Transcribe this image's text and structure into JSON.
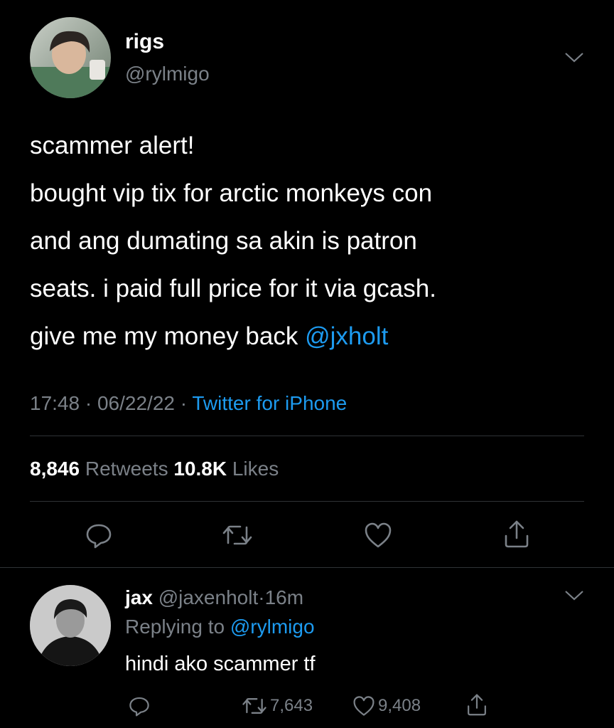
{
  "tweet": {
    "display_name": "rigs",
    "handle": "@rylmigo",
    "text_lines": [
      "scammer alert!",
      "bought vip tix for arctic monkeys con",
      "and ang dumating sa akin is patron",
      "seats. i paid full price for it via gcash."
    ],
    "last_line_text": "give me my money back ",
    "mention": "@jxholt",
    "time": "17:48",
    "dot": "·",
    "date": "06/22/22",
    "source": "Twitter for iPhone",
    "retweets_count": "8,846",
    "retweets_label": "Retweets",
    "likes_count": "10.8K",
    "likes_label": "Likes",
    "actions": [
      "reply-icon",
      "retweet-icon",
      "like-icon",
      "share-icon"
    ]
  },
  "reply": {
    "display_name": "jax",
    "handle": "@jaxenholt",
    "dot": "·",
    "time": "16m",
    "replying_to_label": "Replying to",
    "replying_to_handle": "@rylmigo",
    "text": "hindi ako scammer tf",
    "retweets_count": "7,643",
    "likes_count": "9,408"
  },
  "colors": {
    "background": "#000000",
    "text": "#ffffff",
    "muted": "#7b8188",
    "link": "#1d9bf0",
    "divider": "#2f3336"
  }
}
